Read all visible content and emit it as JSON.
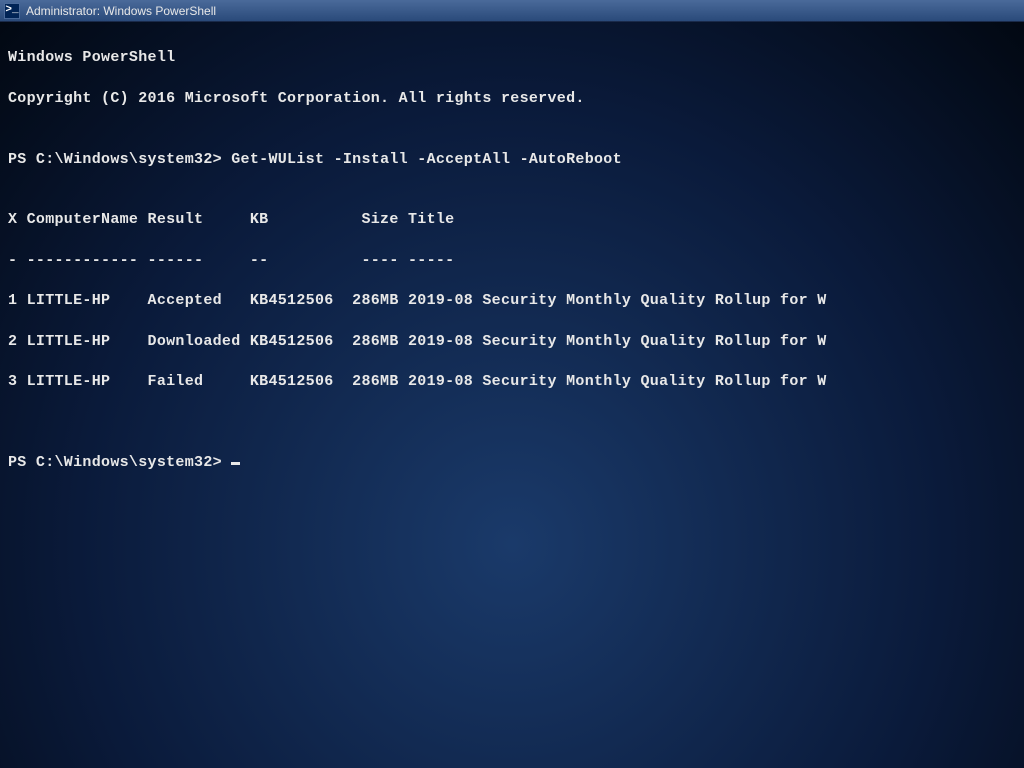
{
  "window": {
    "title": "Administrator: Windows PowerShell",
    "icon_symbol": ">_"
  },
  "terminal": {
    "header_line1": "Windows PowerShell",
    "header_line2": "Copyright (C) 2016 Microsoft Corporation. All rights reserved.",
    "blank": "",
    "prompt1_path": "PS C:\\Windows\\system32> ",
    "command1": "Get-WUList -Install -AcceptAll -AutoReboot",
    "table": {
      "header": "X ComputerName Result     KB          Size Title",
      "underline": "- ------------ ------     --          ---- -----",
      "rows": [
        "1 LITTLE-HP    Accepted   KB4512506  286MB 2019-08 Security Monthly Quality Rollup for W",
        "2 LITTLE-HP    Downloaded KB4512506  286MB 2019-08 Security Monthly Quality Rollup for W",
        "3 LITTLE-HP    Failed     KB4512506  286MB 2019-08 Security Monthly Quality Rollup for W"
      ]
    },
    "prompt2_path": "PS C:\\Windows\\system32> "
  }
}
